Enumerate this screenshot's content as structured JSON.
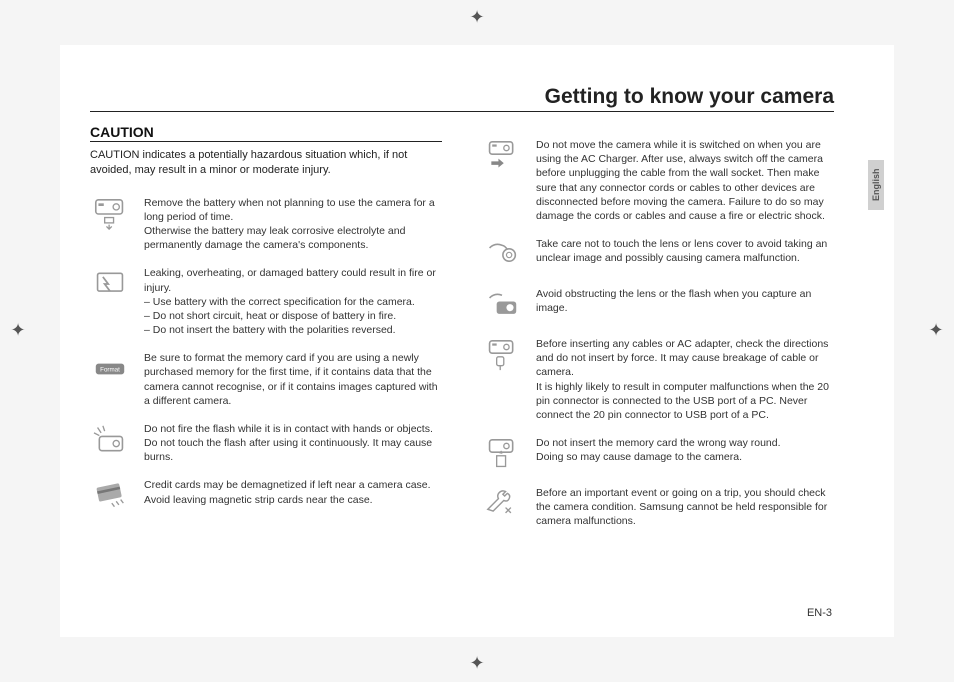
{
  "page_title": "Getting to know your camera",
  "language_tab": "English",
  "page_number": "EN-3",
  "caution": {
    "heading": "CAUTION",
    "intro": "CAUTION indicates a potentially hazardous situation which, if not avoided, may result in a minor or moderate injury."
  },
  "left_items": [
    {
      "icon": "camera-battery-down-icon",
      "text": "Remove the battery when not planning to use the camera for a long period of time.\nOtherwise the battery may leak corrosive electrolyte and permanently damage the camera's components."
    },
    {
      "icon": "battery-leak-icon",
      "text": "Leaking, overheating, or damaged battery could result in fire or injury.\n– Use battery with the correct specification for the camera.\n– Do not short circuit, heat or dispose of battery in fire.\n– Do not insert the battery with the polarities reversed."
    },
    {
      "icon": "format-card-icon",
      "text": "Be sure to format the memory card if you are using a newly purchased memory for the first time, if it contains data that the camera cannot recognise, or if it contains images captured with a different camera."
    },
    {
      "icon": "flash-burn-icon",
      "text": "Do not fire the flash while it is in contact with hands or objects. Do not touch the flash after using it continuously. It may cause burns."
    },
    {
      "icon": "credit-card-magnet-icon",
      "text": "Credit cards may be demagnetized if left near a camera case. Avoid leaving magnetic strip cards near the case."
    }
  ],
  "right_items": [
    {
      "icon": "camera-plug-icon",
      "text": "Do not move the camera while it is switched on when you are using the AC Charger. After use, always switch off the camera before unplugging the cable from the wall socket. Then make sure that any connector cords or cables to other devices are disconnected before moving the camera. Failure to do so may damage the cords or cables and cause a fire or electric shock."
    },
    {
      "icon": "hand-lens-icon",
      "text": "Take care not to touch the lens or lens cover to avoid taking an unclear image and possibly causing camera malfunction."
    },
    {
      "icon": "hand-flash-icon",
      "text": "Avoid obstructing the lens or the flash when you capture an image."
    },
    {
      "icon": "camera-cable-icon",
      "text": "Before inserting any cables or AC adapter, check the directions and do not insert by force. It may cause breakage of cable or camera.\nIt is highly likely to result in computer malfunctions when the 20 pin connector is connected to the USB port of a PC. Never connect the 20 pin connector to USB port of a PC."
    },
    {
      "icon": "memory-card-insert-icon",
      "text": "Do not insert the memory card the wrong way round.\nDoing so may cause damage to the camera."
    },
    {
      "icon": "wrench-check-icon",
      "text": "Before an important event or going on a trip, you should check the camera condition. Samsung cannot be held responsible for camera malfunctions."
    }
  ]
}
